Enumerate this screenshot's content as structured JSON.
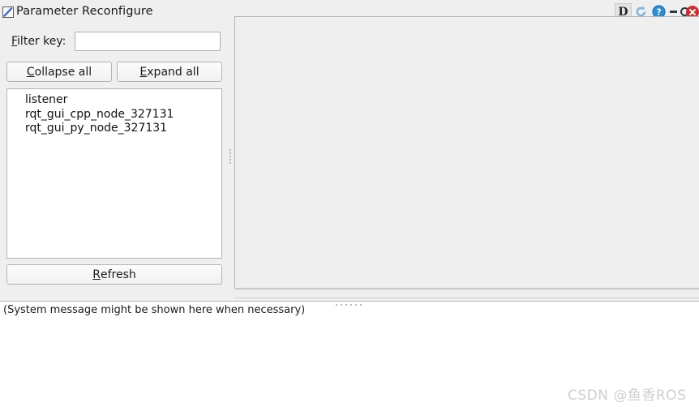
{
  "window": {
    "title": "Parameter Reconfigure",
    "icon": "reconfigure-page-icon",
    "titlebar_buttons": {
      "dock_label": "D",
      "reload_label": "reload-icon",
      "help_label": "?",
      "minimize_label": "minimize-icon",
      "maximize_label": "maximize-icon",
      "close_label": "close-icon"
    }
  },
  "left_pane": {
    "filter": {
      "label_accel": "F",
      "label_rest": "ilter key:",
      "value": "",
      "placeholder": ""
    },
    "collapse_button": {
      "accel": "C",
      "rest": "ollapse all"
    },
    "expand_button": {
      "accel": "E",
      "rest": "xpand all"
    },
    "refresh_button": {
      "accel": "R",
      "rest": "efresh"
    },
    "node_list": [
      "listener",
      "rqt_gui_cpp_node_327131",
      "rqt_gui_py_node_327131"
    ]
  },
  "right_pane": {
    "content": ""
  },
  "status": {
    "message": "(System message might be shown here when necessary)"
  },
  "watermark": {
    "text": "CSDN @鱼香ROS"
  },
  "colors": {
    "app_background": "#efefef",
    "field_background": "#ffffff",
    "border": "#b4b4b4",
    "close_red": "#d02c2c",
    "help_blue": "#2a8fd4",
    "reload_blue": "#7fb8e0"
  }
}
